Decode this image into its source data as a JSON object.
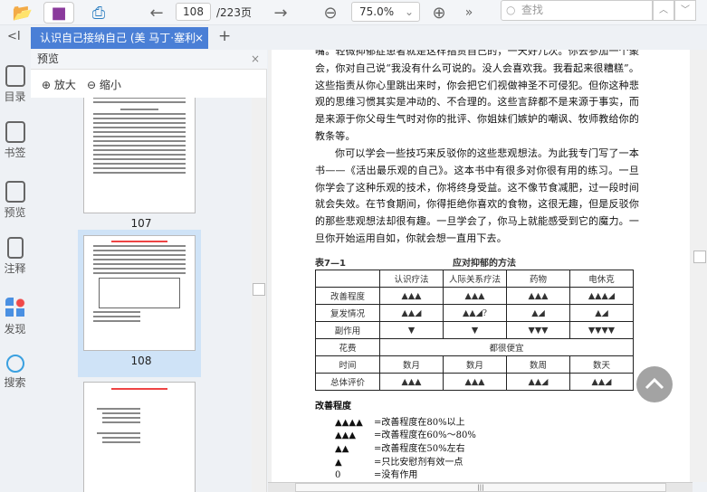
{
  "toolbar": {
    "page_current": "108",
    "page_total": "/223页",
    "zoom": "75.0%",
    "search_placeholder": "查找"
  },
  "tab": {
    "title": "认识自己接纳自己 (美 马丁·塞利格曼)",
    "close": "×",
    "add": "+",
    "collapse": "<I"
  },
  "rail": [
    {
      "label": "目录",
      "icon": "toc-icon"
    },
    {
      "label": "书签",
      "icon": "bookmark-icon"
    },
    {
      "label": "预览",
      "icon": "preview-icon"
    },
    {
      "label": "注释",
      "icon": "annotation-icon"
    },
    {
      "label": "发现",
      "icon": "discover-icon"
    },
    {
      "label": "搜索",
      "icon": "search-icon"
    }
  ],
  "preview": {
    "title": "预览",
    "close": "×",
    "zoom_in": "放大",
    "zoom_out": "缩小",
    "pages": [
      "107",
      "108"
    ]
  },
  "document": {
    "paragraphs": [
      "嘴。轻微抑郁症患者就是这样指责自己的，一天好几次。你去参加一个聚会，你对自己说“我没有什么可说的。没人会喜欢我。我看起来很糟糕”。这些指责从你心里跳出来时，你会把它们视做神圣不可侵犯。但你这种悲观的思维习惯其实是冲动的、不合理的。这些言辞都不是来源于事实，而是来源于你父母生气时对你的批评、你姐妹们嫉妒的嘲讽、牧师教给你的教条等。",
      "你可以学会一些技巧来反驳你的这些悲观想法。为此我专门写了一本书——《活出最乐观的自己》。这本书中有很多对你很有用的练习。一旦你学会了这种乐观的技术，你将终身受益。这不像节食减肥，过一段时间就会失效。在节食期间，你得拒绝你喜欢的食物，这很无趣，但是反驳你的那些悲观想法却很有趣。一旦学会了，你马上就能感受到它的魔力。一旦你开始运用自如，你就会想一直用下去。"
    ],
    "table_label": "表7—1",
    "table_title": "应对抑郁的方法",
    "table_header": [
      "",
      "认识疗法",
      "人际关系疗法",
      "药物",
      "电休克"
    ],
    "table_rows": [
      [
        "改善程度",
        "▲▲▲",
        "▲▲▲",
        "▲▲▲",
        "▲▲▲◢"
      ],
      [
        "复发情况",
        "▲▲◢",
        "▲▲◢?",
        "▲◢",
        "▲◢"
      ],
      [
        "副作用",
        "▼",
        "▼",
        "▼▼▼",
        "▼▼▼▼"
      ],
      [
        "花费",
        "都很便宜"
      ],
      [
        "时间",
        "数月",
        "数月",
        "数周",
        "数天"
      ],
      [
        "总体评价",
        "▲▲▲",
        "▲▲▲",
        "▲▲◢",
        "▲▲◢"
      ]
    ],
    "legend_title": "改善程度",
    "legend": [
      [
        "▲▲▲▲",
        "=改善程度在80%以上"
      ],
      [
        "▲▲▲",
        "=改善程度在60%～80%"
      ],
      [
        "▲▲",
        "=改善程度在50%左右"
      ],
      [
        "▲",
        "=只比安慰剂有效一点"
      ],
      [
        "0",
        "=没有作用"
      ]
    ]
  }
}
